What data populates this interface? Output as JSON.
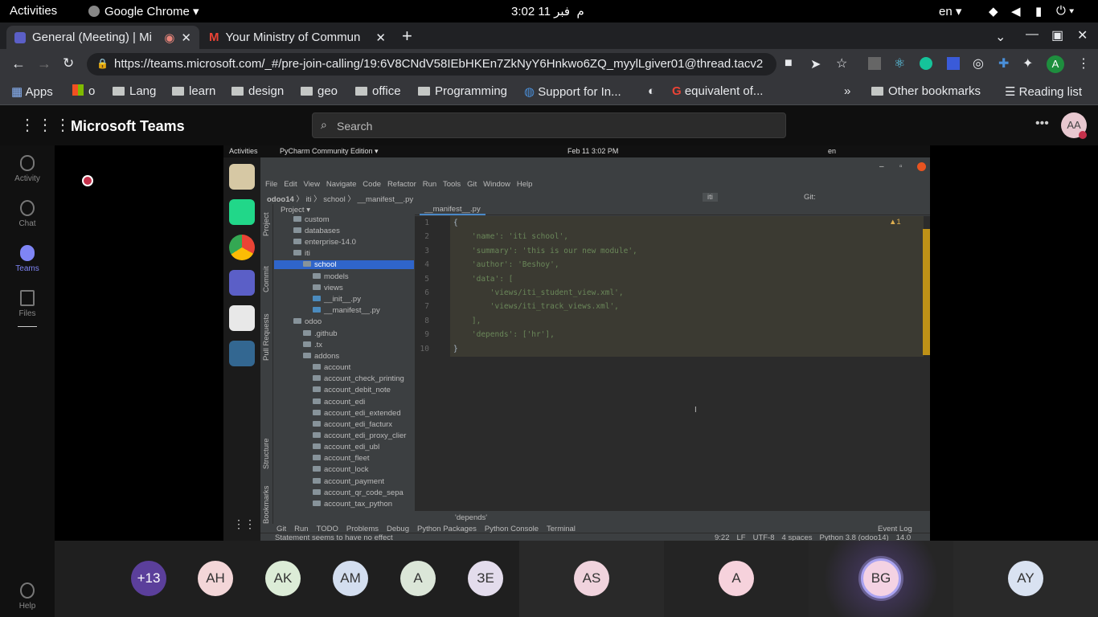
{
  "gnome": {
    "activities": "Activities",
    "app": "Google Chrome",
    "clock": "3:02  م",
    "date": "فبر 11",
    "lang": "en"
  },
  "tabs": [
    {
      "title": "General (Meeting) | Mi"
    },
    {
      "title": "Your Ministry of Commun"
    }
  ],
  "url": "https://teams.microsoft.com/_#/pre-join-calling/19:6V8CNdV58IEbHKEn7ZkNyY6Hnkwo6ZQ_myylLgiver01@thread.tacv2",
  "profile_letter": "A",
  "bookmarks": [
    {
      "label": "Apps",
      "icon": "apps-grid-icon"
    },
    {
      "label": "o",
      "icon": "microsoft-icon"
    },
    {
      "label": "Lang",
      "icon": "folder-icon"
    },
    {
      "label": "learn",
      "icon": "folder-icon"
    },
    {
      "label": "design",
      "icon": "folder-icon"
    },
    {
      "label": "geo",
      "icon": "folder-icon"
    },
    {
      "label": "office",
      "icon": "folder-icon"
    },
    {
      "label": "Programming",
      "icon": "folder-icon"
    },
    {
      "label": "Support for In...",
      "icon": "globe-icon"
    },
    {
      "label": "",
      "icon": "world-icon"
    },
    {
      "label": "equivalent of...",
      "icon": "google-icon"
    }
  ],
  "other_bookmarks": "Other bookmarks",
  "reading_list": "Reading list",
  "teams": {
    "title": "Microsoft Teams",
    "search_placeholder": "Search",
    "avatar": "AA",
    "rail": [
      {
        "label": "Activity",
        "icon": "bell-icon"
      },
      {
        "label": "Chat",
        "icon": "chat-icon"
      },
      {
        "label": "Teams",
        "icon": "teams-icon"
      },
      {
        "label": "Files",
        "icon": "file-icon"
      }
    ],
    "help": "Help"
  },
  "participants": [
    {
      "initials": "+13",
      "bg": "#5b3f9b",
      "fg": "#ffffff"
    },
    {
      "initials": "AH",
      "bg": "#f3d6d8"
    },
    {
      "initials": "AK",
      "bg": "#dcecd7"
    },
    {
      "initials": "AM",
      "bg": "#d3deef"
    },
    {
      "initials": "A",
      "bg": "#dbe6d8"
    },
    {
      "initials": "ЗЕ",
      "bg": "#e3dcec"
    },
    {
      "initials": "AS",
      "bg": "#f0d3dd"
    },
    {
      "initials": "A",
      "bg": "#f6d2dc"
    },
    {
      "initials": "BG",
      "bg": "#f4d2e3"
    },
    {
      "initials": "AY",
      "bg": "#d9e2f1"
    }
  ],
  "shared": {
    "topbar": {
      "activities": "Activities",
      "app": "PyCharm Community Edition",
      "clock": "Feb 11  3:02 PM",
      "lang": "en"
    },
    "menu": [
      "File",
      "Edit",
      "View",
      "Navigate",
      "Code",
      "Refactor",
      "Run",
      "Tools",
      "Git",
      "Window",
      "Help"
    ],
    "breadcrumb": [
      "odoo14",
      "iti",
      "school",
      "__manifest__.py"
    ],
    "branch": "iti",
    "git_label": "Git:",
    "tab": "__manifest__.py",
    "project_label": "Project",
    "warnings": "▲1",
    "side_tabs": [
      "Project",
      "Commit",
      "Pull Requests",
      "Structure",
      "Bookmarks"
    ],
    "tree": [
      {
        "name": "custom",
        "depth": 1,
        "type": "folder"
      },
      {
        "name": "databases",
        "depth": 1,
        "type": "folder"
      },
      {
        "name": "enterprise-14.0",
        "depth": 1,
        "type": "folder"
      },
      {
        "name": "iti",
        "depth": 1,
        "type": "folder"
      },
      {
        "name": "school",
        "depth": 2,
        "type": "folder"
      },
      {
        "name": "models",
        "depth": 3,
        "type": "folder"
      },
      {
        "name": "views",
        "depth": 3,
        "type": "folder"
      },
      {
        "name": "__init__.py",
        "depth": 3,
        "type": "py"
      },
      {
        "name": "__manifest__.py",
        "depth": 3,
        "type": "py"
      },
      {
        "name": "odoo",
        "depth": 1,
        "type": "folder"
      },
      {
        "name": ".github",
        "depth": 2,
        "type": "folder"
      },
      {
        "name": ".tx",
        "depth": 2,
        "type": "folder"
      },
      {
        "name": "addons",
        "depth": 2,
        "type": "folder"
      },
      {
        "name": "account",
        "depth": 3,
        "type": "folder"
      },
      {
        "name": "account_check_printing",
        "depth": 3,
        "type": "folder"
      },
      {
        "name": "account_debit_note",
        "depth": 3,
        "type": "folder"
      },
      {
        "name": "account_edi",
        "depth": 3,
        "type": "folder"
      },
      {
        "name": "account_edi_extended",
        "depth": 3,
        "type": "folder"
      },
      {
        "name": "account_edi_facturx",
        "depth": 3,
        "type": "folder"
      },
      {
        "name": "account_edi_proxy_clier",
        "depth": 3,
        "type": "folder"
      },
      {
        "name": "account_edi_ubl",
        "depth": 3,
        "type": "folder"
      },
      {
        "name": "account_fleet",
        "depth": 3,
        "type": "folder"
      },
      {
        "name": "account_lock",
        "depth": 3,
        "type": "folder"
      },
      {
        "name": "account_payment",
        "depth": 3,
        "type": "folder"
      },
      {
        "name": "account_qr_code_sepa",
        "depth": 3,
        "type": "folder"
      },
      {
        "name": "account_tax_python",
        "depth": 3,
        "type": "folder"
      }
    ],
    "code": [
      "{",
      "    'name': 'iti school',",
      "    'summary': 'this is our new module',",
      "    'author': 'Beshoy',",
      "    'data': [",
      "        'views/iti_student_view.xml',",
      "        'views/iti_track_views.xml',",
      "    ],",
      "    'depends': ['hr'],",
      "}"
    ],
    "line_numbers": [
      "1",
      "2",
      "3",
      "4",
      "5",
      "6",
      "7",
      "8",
      "9",
      "10"
    ],
    "hint": "'depends'",
    "tool_tabs": [
      "Git",
      "Run",
      "TODO",
      "Problems",
      "Debug",
      "Python Packages",
      "Python Console",
      "Terminal"
    ],
    "event_log": "Event Log",
    "status_msg": "Statement seems to have no effect",
    "status_right": [
      "9:22",
      "LF",
      "UTF-8",
      "4 spaces",
      "Python 3.8 (odoo14)",
      "14.0"
    ]
  }
}
